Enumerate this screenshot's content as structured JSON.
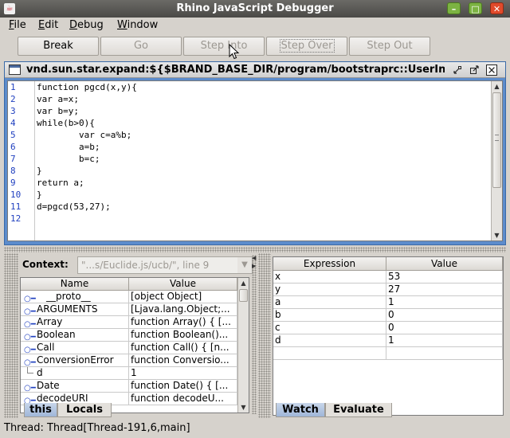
{
  "window": {
    "title": "Rhino JavaScript Debugger",
    "min_glyph": "–",
    "max_glyph": "□",
    "close_glyph": "✕"
  },
  "menu": [
    {
      "label": "File",
      "mnemonic": "F",
      "rest": "ile"
    },
    {
      "label": "Edit",
      "mnemonic": "E",
      "rest": "dit"
    },
    {
      "label": "Debug",
      "mnemonic": "D",
      "rest": "ebug"
    },
    {
      "label": "Window",
      "mnemonic": "W",
      "rest": "indow"
    }
  ],
  "toolbar": {
    "break_label": "Break",
    "go_label": "Go",
    "step_into_label": "Step Into",
    "step_over_label": "Step Over",
    "step_out_label": "Step Out"
  },
  "script_frame": {
    "title": "vnd.sun.star.expand:${$BRAND_BASE_DIR/program/bootstraprc::UserIn...",
    "line_numbers": [
      "1",
      "2",
      "3",
      "4",
      "5",
      "6",
      "7",
      "8",
      "9",
      "10",
      "11",
      "12"
    ],
    "code_lines": [
      "function pgcd(x,y){",
      "var a=x;",
      "var b=y;",
      "while(b>0){",
      "        var c=a%b;",
      "        a=b;",
      "        b=c;",
      "}",
      "return a;",
      "}",
      "d=pgcd(53,27);",
      ""
    ]
  },
  "context": {
    "label": "Context:",
    "value": "\"...s/Euclide.js/ucb/\", line 9"
  },
  "variables": {
    "headers": {
      "name": "Name",
      "value": "Value"
    },
    "rows": [
      {
        "name": "__proto__",
        "value": "[object Object]"
      },
      {
        "name": "ARGUMENTS",
        "value": "[Ljava.lang.Object;..."
      },
      {
        "name": "Array",
        "value": "function Array() { [..."
      },
      {
        "name": "Boolean",
        "value": "function Boolean()..."
      },
      {
        "name": "Call",
        "value": "function Call() { [n..."
      },
      {
        "name": "ConversionError",
        "value": "function Conversio..."
      },
      {
        "name": "d",
        "value": "1"
      },
      {
        "name": "Date",
        "value": "function Date() { [..."
      },
      {
        "name": "decodeURI",
        "value": "function decodeU..."
      }
    ],
    "tabs": [
      "this",
      "Locals"
    ]
  },
  "watch": {
    "headers": {
      "expression": "Expression",
      "value": "Value"
    },
    "rows": [
      {
        "expression": "x",
        "value": "53"
      },
      {
        "expression": "y",
        "value": "27"
      },
      {
        "expression": "a",
        "value": "1"
      },
      {
        "expression": "b",
        "value": "0"
      },
      {
        "expression": "c",
        "value": "0"
      },
      {
        "expression": "d",
        "value": "1"
      },
      {
        "expression": "",
        "value": ""
      }
    ],
    "tabs": [
      "Watch",
      "Evaluate"
    ]
  },
  "status": "Thread: Thread[Thread-191,6,main]"
}
